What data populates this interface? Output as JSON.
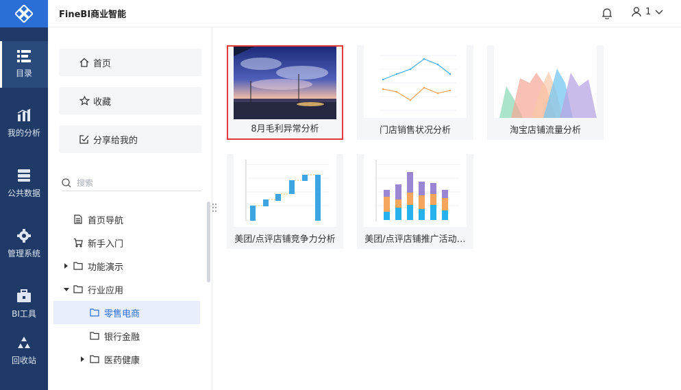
{
  "header": {
    "brand": "FineBI商业智能",
    "user_label": "1"
  },
  "nav": {
    "items": [
      {
        "label": "目录",
        "icon": "catalog-icon",
        "active": true
      },
      {
        "label": "我的分析",
        "icon": "analysis-icon"
      },
      {
        "label": "公共数据",
        "icon": "database-icon"
      },
      {
        "label": "管理系统",
        "icon": "gear-icon"
      },
      {
        "label": "BI工具",
        "icon": "toolbox-icon"
      },
      {
        "label": "回收站",
        "icon": "recycle-icon"
      }
    ]
  },
  "sidebar": {
    "quick": [
      {
        "label": "首页",
        "icon": "home-icon"
      },
      {
        "label": "收藏",
        "icon": "star-icon"
      },
      {
        "label": "分享给我的",
        "icon": "share-icon"
      }
    ],
    "search_placeholder": "搜索",
    "tree": [
      {
        "label": "首页导航",
        "icon": "document-icon"
      },
      {
        "label": "新手入门",
        "icon": "cart-icon"
      },
      {
        "label": "功能演示",
        "icon": "folder-icon",
        "expanded": false
      },
      {
        "label": "行业应用",
        "icon": "folder-icon",
        "expanded": true
      },
      {
        "label": "零售电商",
        "icon": "folder-icon",
        "selected": true
      },
      {
        "label": "银行金融",
        "icon": "folder-icon"
      },
      {
        "label": "医药健康",
        "icon": "folder-icon",
        "expanded": false
      }
    ]
  },
  "cards": [
    {
      "title": "8月毛利异常分析",
      "thumb": "photo",
      "selected": true
    },
    {
      "title": "门店销售状况分析",
      "thumb": "line-chart"
    },
    {
      "title": "淘宝店铺流量分析",
      "thumb": "area-chart"
    },
    {
      "title": "美团/点评店铺竞争力分析",
      "thumb": "waterfall-chart"
    },
    {
      "title": "美团/点评店铺推广活动…",
      "thumb": "stacked-bar-chart"
    }
  ],
  "colors": {
    "nav_bg": "#1f3a66",
    "accent": "#2b6fd6",
    "selected_border": "#e4393c"
  }
}
